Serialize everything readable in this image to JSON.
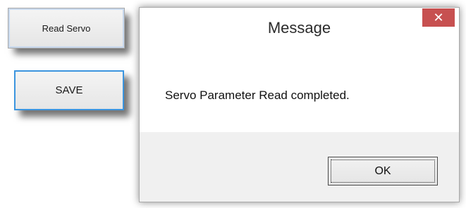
{
  "side_buttons": {
    "read_servo_label": "Read Servo",
    "save_label": "SAVE"
  },
  "dialog": {
    "title": "Message",
    "close_glyph": "✕",
    "message": "Servo Parameter Read completed.",
    "ok_label": "OK"
  },
  "colors": {
    "close_button": "#c75050",
    "save_focus_border": "#3c95df",
    "footer_background": "#f0f0f0"
  }
}
